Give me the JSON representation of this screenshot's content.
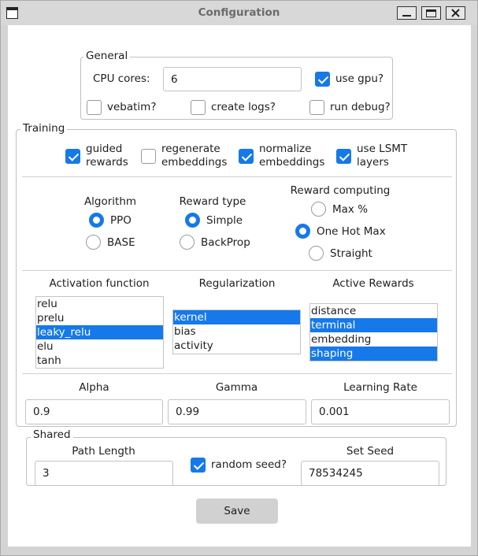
{
  "window": {
    "title": "Configuration"
  },
  "general": {
    "legend": "General",
    "cpu_label": "CPU cores:",
    "cpu_value": "6",
    "use_gpu": {
      "label": "use gpu?",
      "checked": true
    },
    "vebatim": {
      "label": "vebatim?",
      "checked": false
    },
    "create_logs": {
      "label": "create logs?",
      "checked": false
    },
    "run_debug": {
      "label": "run debug?",
      "checked": false
    }
  },
  "training": {
    "legend": "Training",
    "guided": {
      "line1": "guided",
      "line2": "rewards",
      "checked": true
    },
    "regenerate": {
      "line1": "regenerate",
      "line2": "embeddings",
      "checked": false
    },
    "normalize": {
      "line1": "normalize",
      "line2": "embeddings",
      "checked": true
    },
    "lsmt": {
      "line1": "use LSMT",
      "line2": "layers",
      "checked": true
    },
    "algorithm": {
      "header": "Algorithm",
      "options": [
        "PPO",
        "BASE"
      ],
      "selected": "PPO"
    },
    "reward_type": {
      "header": "Reward type",
      "options": [
        "Simple",
        "BackProp"
      ],
      "selected": "Simple"
    },
    "reward_computing": {
      "header": "Reward computing",
      "options": [
        "Max %",
        "One Hot Max",
        "Straight"
      ],
      "selected": "One Hot Max"
    },
    "activation": {
      "header": "Activation function",
      "items": [
        "relu",
        "prelu",
        "leaky_relu",
        "elu",
        "tanh"
      ],
      "selected": [
        "leaky_relu"
      ]
    },
    "regularization": {
      "header": "Regularization",
      "items": [
        "kernel",
        "bias",
        "activity"
      ],
      "selected": [
        "kernel"
      ]
    },
    "active_rewards": {
      "header": "Active Rewards",
      "items": [
        "distance",
        "terminal",
        "embedding",
        "shaping"
      ],
      "selected": [
        "terminal",
        "shaping"
      ]
    },
    "alpha": {
      "label": "Alpha",
      "value": "0.9"
    },
    "gamma": {
      "label": "Gamma",
      "value": "0.99"
    },
    "learning_rate": {
      "label": "Learning Rate",
      "value": "0.001"
    }
  },
  "shared": {
    "legend": "Shared",
    "path_length": {
      "label": "Path Length",
      "value": "3"
    },
    "random_seed": {
      "label": "random seed?",
      "checked": true
    },
    "set_seed": {
      "label": "Set Seed",
      "value": "78534245"
    }
  },
  "save_label": "Save",
  "colors": {
    "accent": "#1679e9",
    "window_bg": "#d4d4d4",
    "content_bg": "#ffffff",
    "button_bg": "#d1d1d1"
  }
}
